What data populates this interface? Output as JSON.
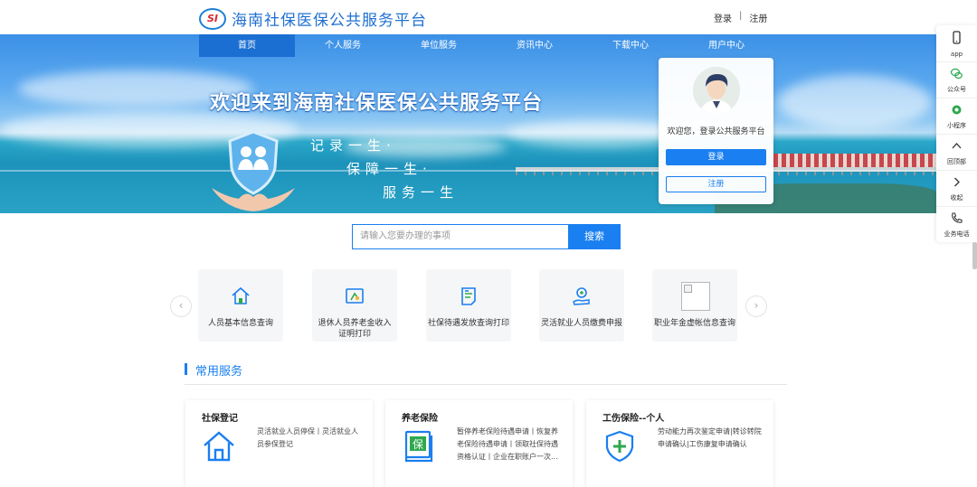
{
  "header": {
    "logo_mark": "SI",
    "site_title": "海南社保医保公共服务平台",
    "login_link": "登录",
    "separator": "|",
    "register_link": "注册"
  },
  "nav": {
    "items": [
      {
        "label": "首页",
        "active": true
      },
      {
        "label": "个人服务",
        "active": false
      },
      {
        "label": "单位服务",
        "active": false
      },
      {
        "label": "资讯中心",
        "active": false
      },
      {
        "label": "下载中心",
        "active": false
      },
      {
        "label": "用户中心",
        "active": false
      }
    ]
  },
  "banner": {
    "title": "欢迎来到海南社保医保公共服务平台",
    "slogan1": "记录一生·",
    "slogan2": "保障一生·",
    "slogan3": "服务一生"
  },
  "login_card": {
    "welcome": "欢迎您，登录公共服务平台",
    "login_button": "登录",
    "register_button": "注册"
  },
  "sidebar": {
    "items": [
      {
        "label": "app",
        "icon": "phone-icon"
      },
      {
        "label": "公众号",
        "icon": "wechat-icon"
      },
      {
        "label": "小程序",
        "icon": "mini-program-icon"
      },
      {
        "label": "回顶部",
        "icon": "chevron-up-icon"
      },
      {
        "label": "收起",
        "icon": "chevron-right-icon"
      },
      {
        "label": "业务电话",
        "icon": "telephone-icon"
      }
    ]
  },
  "search": {
    "placeholder": "请输入您要办理的事项",
    "button": "搜索"
  },
  "quick_services": {
    "prev": "‹",
    "next": "›",
    "tiles": [
      {
        "label": "人员基本信息查询",
        "icon": "home-icon"
      },
      {
        "label": "退休人员养老金收入证明打印",
        "icon": "certificate-icon"
      },
      {
        "label": "社保待遇发放查询打印",
        "icon": "document-icon"
      },
      {
        "label": "灵活就业人员缴费申报",
        "icon": "payment-hand-icon"
      },
      {
        "label": "职业年金虚帐信息查询",
        "icon": "broken-image-icon"
      }
    ]
  },
  "common_services": {
    "title": "常用服务",
    "cards": [
      {
        "title": "社保登记",
        "desc": "灵活就业人员停保丨灵活就业人员参保登记",
        "icon": "house-icon"
      },
      {
        "title": "养老保险",
        "desc": "暂停养老保险待遇申请丨恢复养老保险待遇申请丨领取社保待遇资格认证丨企业在职账户一次...",
        "icon": "pension-book-icon"
      },
      {
        "title": "工伤保险--个人",
        "desc": "劳动能力再次鉴定申请|转诊转院申请确认|工伤康复申请确认",
        "icon": "shield-plus-icon"
      }
    ]
  },
  "colors": {
    "primary": "#1a7ff0",
    "nav_active": "#1c6fd2",
    "title_blue": "#1f6fd1",
    "icon_green": "#2ea84e"
  }
}
